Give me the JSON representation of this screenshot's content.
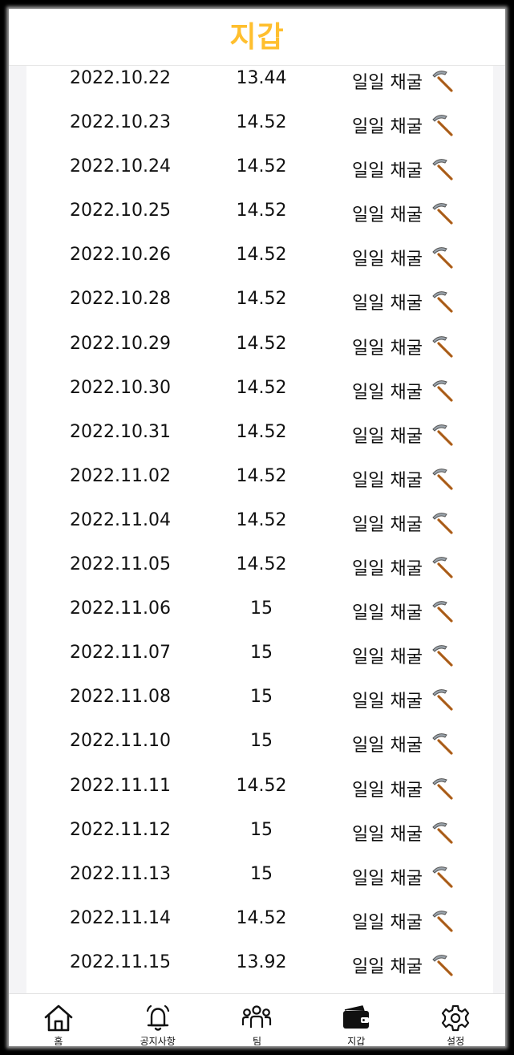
{
  "header": {
    "title": "지갑",
    "title_color": "#ffbf2e"
  },
  "transactions": [
    {
      "date": "2022.10.22",
      "amount": "13.44",
      "type": "일일 채굴"
    },
    {
      "date": "2022.10.23",
      "amount": "14.52",
      "type": "일일 채굴"
    },
    {
      "date": "2022.10.24",
      "amount": "14.52",
      "type": "일일 채굴"
    },
    {
      "date": "2022.10.25",
      "amount": "14.52",
      "type": "일일 채굴"
    },
    {
      "date": "2022.10.26",
      "amount": "14.52",
      "type": "일일 채굴"
    },
    {
      "date": "2022.10.28",
      "amount": "14.52",
      "type": "일일 채굴"
    },
    {
      "date": "2022.10.29",
      "amount": "14.52",
      "type": "일일 채굴"
    },
    {
      "date": "2022.10.30",
      "amount": "14.52",
      "type": "일일 채굴"
    },
    {
      "date": "2022.10.31",
      "amount": "14.52",
      "type": "일일 채굴"
    },
    {
      "date": "2022.11.02",
      "amount": "14.52",
      "type": "일일 채굴"
    },
    {
      "date": "2022.11.04",
      "amount": "14.52",
      "type": "일일 채굴"
    },
    {
      "date": "2022.11.05",
      "amount": "14.52",
      "type": "일일 채굴"
    },
    {
      "date": "2022.11.06",
      "amount": "15",
      "type": "일일 채굴"
    },
    {
      "date": "2022.11.07",
      "amount": "15",
      "type": "일일 채굴"
    },
    {
      "date": "2022.11.08",
      "amount": "15",
      "type": "일일 채굴"
    },
    {
      "date": "2022.11.10",
      "amount": "15",
      "type": "일일 채굴"
    },
    {
      "date": "2022.11.11",
      "amount": "14.52",
      "type": "일일 채굴"
    },
    {
      "date": "2022.11.12",
      "amount": "15",
      "type": "일일 채굴"
    },
    {
      "date": "2022.11.13",
      "amount": "15",
      "type": "일일 채굴"
    },
    {
      "date": "2022.11.14",
      "amount": "14.52",
      "type": "일일 채굴"
    },
    {
      "date": "2022.11.15",
      "amount": "13.92",
      "type": "일일 채굴"
    }
  ],
  "row_icon": "pick-icon",
  "tabbar": {
    "items": [
      {
        "label": "홈",
        "icon": "home-icon"
      },
      {
        "label": "공지사항",
        "icon": "bell-icon"
      },
      {
        "label": "팀",
        "icon": "team-icon"
      },
      {
        "label": "지갑",
        "icon": "wallet-icon",
        "active": true
      },
      {
        "label": "설정",
        "icon": "gear-icon"
      }
    ]
  }
}
